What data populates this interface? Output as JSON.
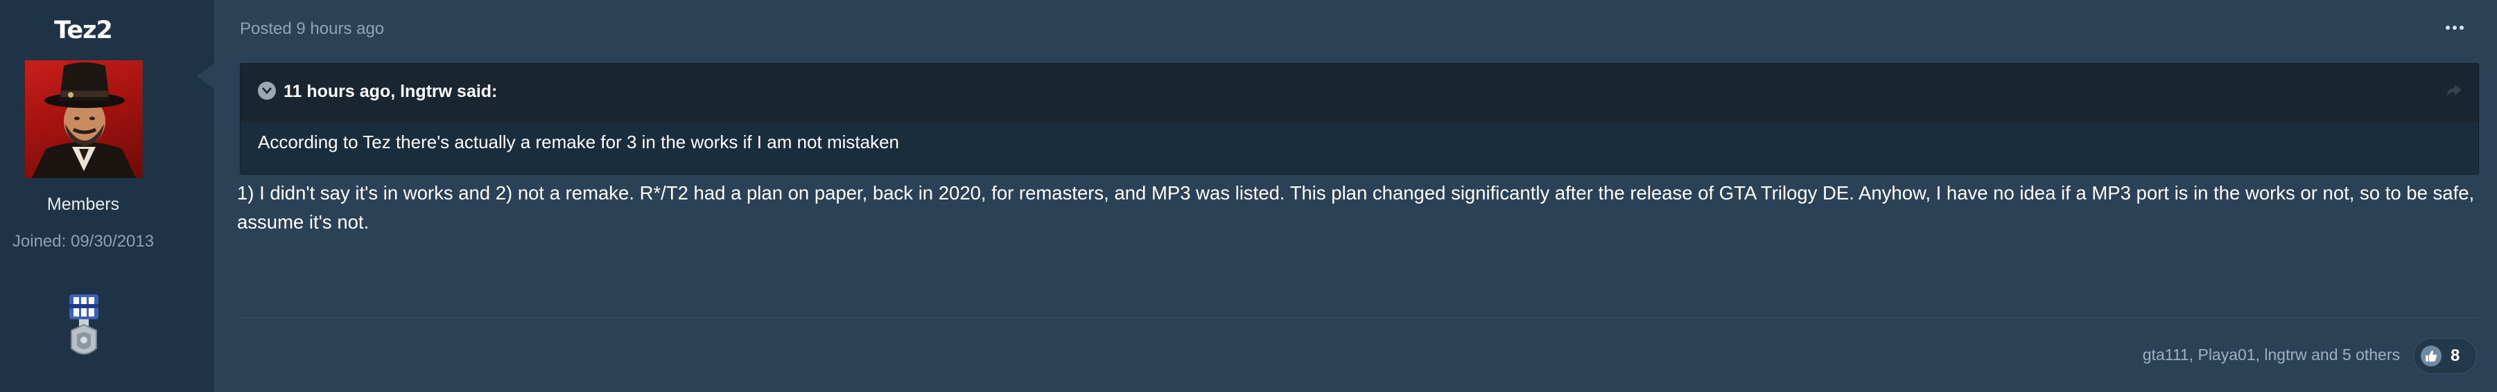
{
  "author": {
    "name": "Tez2",
    "group": "Members",
    "joined_label": "Joined:",
    "joined_date": "09/30/2013",
    "avatar_icon": "avatar-red-dead-character",
    "badge_icon": "rank-medal-icon"
  },
  "post": {
    "posted_label": "Posted",
    "posted_time": "9 hours ago",
    "menu_icon": "more-options-icon",
    "quote": {
      "citation": "11 hours ago, lngtrw said:",
      "text": "According to Tez there's actually a remake for 3 in the works if I am not mistaken"
    },
    "body": "1) I didn't say it's in works and 2) not a remake. R*/T2 had a plan on paper, back in 2020, for remasters, and MP3 was listed. This plan changed significantly after the release of GTA Trilogy DE. Anyhow, I have no idea if a MP3 port is in the works or not, so to be safe, assume it's not."
  },
  "reactions": {
    "names": "gta111, Playa01, lngtrw and 5 others",
    "count": "8",
    "icon": "thumbs-up-icon"
  },
  "colors": {
    "background": "#2a4156",
    "sidebar": "#1e3346",
    "quote_header": "#19262f",
    "meta_text": "#8fa4b8"
  }
}
